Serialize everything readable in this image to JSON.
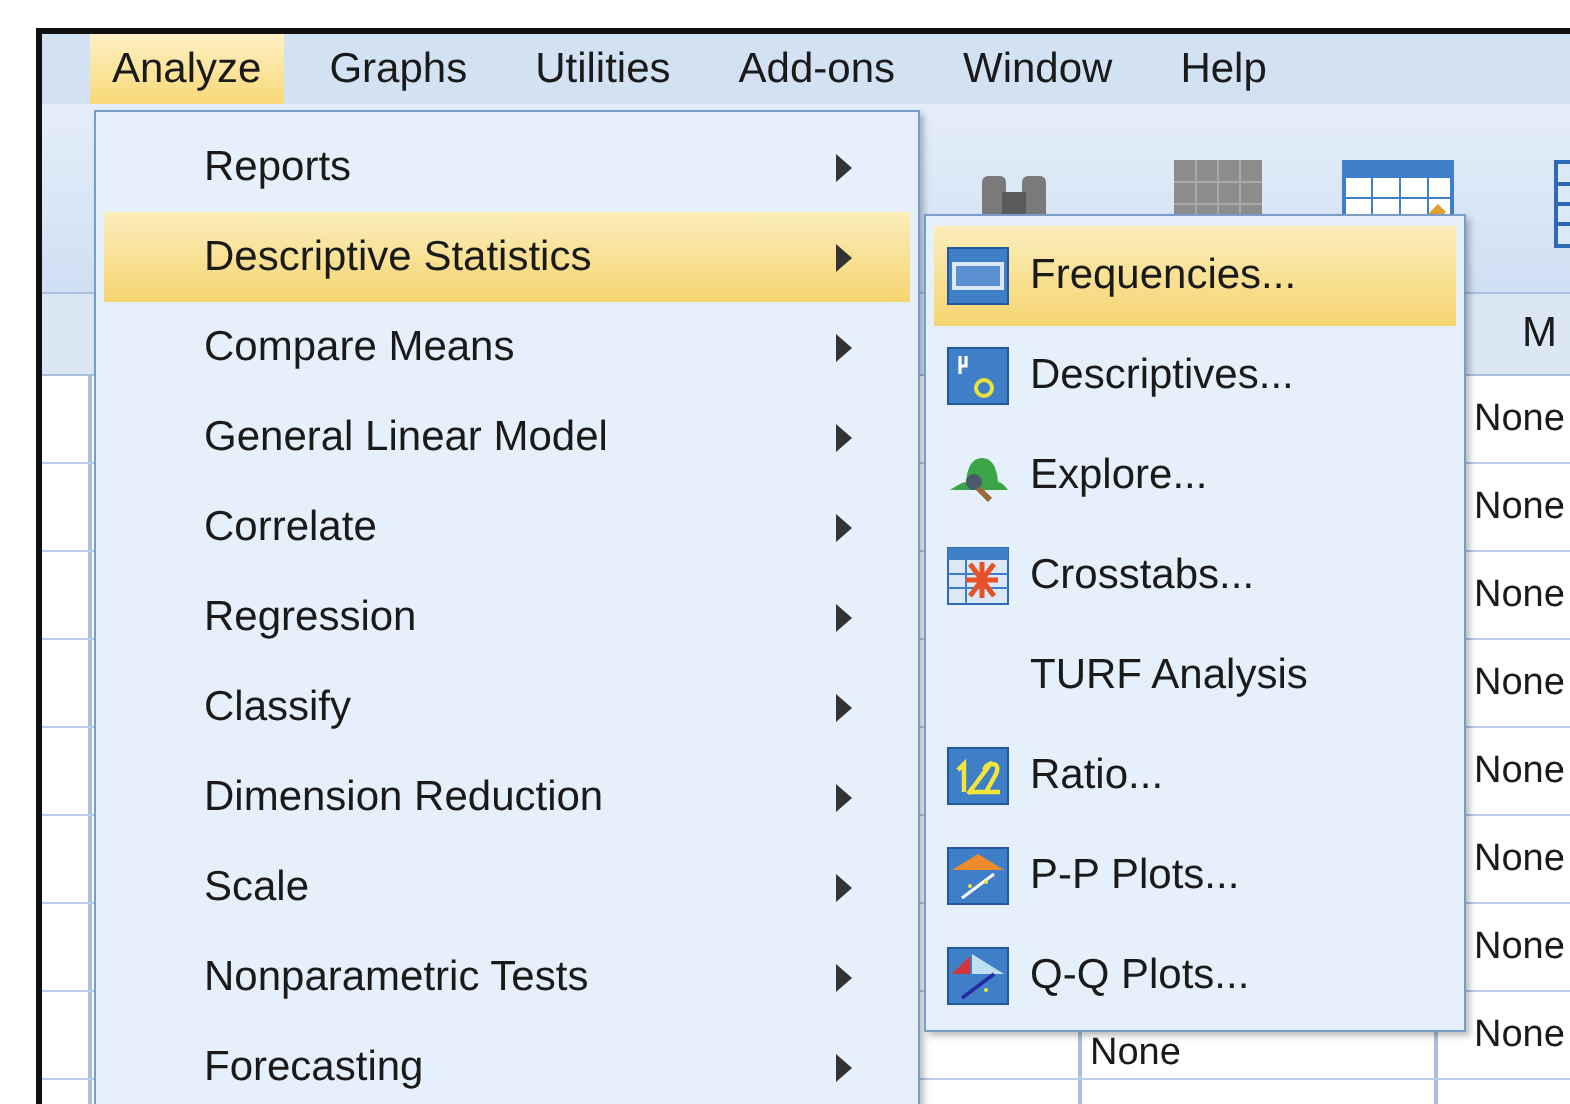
{
  "menubar": [
    {
      "label": "Analyze",
      "selected": true
    },
    {
      "label": "Graphs",
      "selected": false
    },
    {
      "label": "Utilities",
      "selected": false
    },
    {
      "label": "Add-ons",
      "selected": false
    },
    {
      "label": "Window",
      "selected": false
    },
    {
      "label": "Help",
      "selected": false
    }
  ],
  "analyze_menu": {
    "items": [
      {
        "label": "Reports",
        "selected": false
      },
      {
        "label": "Descriptive Statistics",
        "selected": true
      },
      {
        "label": "Compare Means",
        "selected": false
      },
      {
        "label": "General Linear Model",
        "selected": false
      },
      {
        "label": "Correlate",
        "selected": false
      },
      {
        "label": "Regression",
        "selected": false
      },
      {
        "label": "Classify",
        "selected": false
      },
      {
        "label": "Dimension Reduction",
        "selected": false
      },
      {
        "label": "Scale",
        "selected": false
      },
      {
        "label": "Nonparametric Tests",
        "selected": false
      },
      {
        "label": "Forecasting",
        "selected": false
      }
    ]
  },
  "descriptive_submenu": {
    "items": [
      {
        "label": "Frequencies...",
        "selected": true,
        "kind": "frequencies"
      },
      {
        "label": "Descriptives...",
        "selected": false,
        "kind": "descriptives"
      },
      {
        "label": "Explore...",
        "selected": false,
        "kind": "explore"
      },
      {
        "label": "Crosstabs...",
        "selected": false,
        "kind": "crosstabs"
      },
      {
        "label": "TURF Analysis",
        "selected": false,
        "kind": "plain"
      },
      {
        "label": "Ratio...",
        "selected": false,
        "kind": "ratio"
      },
      {
        "label": "P-P Plots...",
        "selected": false,
        "kind": "ppplot"
      },
      {
        "label": "Q-Q Plots...",
        "selected": false,
        "kind": "qqplot"
      }
    ]
  },
  "grid": {
    "column_4_header": "M",
    "column_3_cells": [
      "",
      "",
      "",
      "",
      "",
      "",
      "",
      "None"
    ],
    "column_4_cells": [
      "None",
      "None",
      "None",
      "None",
      "None",
      "None",
      "None",
      "None"
    ]
  }
}
